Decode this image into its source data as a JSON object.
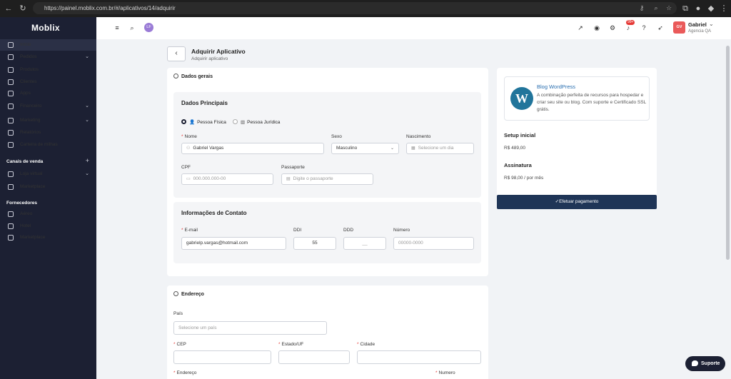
{
  "browser": {
    "url": "https://painel.moblix.com.br/#/aplicativos/14/adquirir"
  },
  "sidebar": {
    "logo": "Moblix",
    "items": [
      {
        "label": "Início",
        "active": true
      },
      {
        "label": "Pedidos",
        "chevron": true
      },
      {
        "label": "Produtos"
      },
      {
        "label": "Clientes"
      },
      {
        "label": "Apps"
      },
      {
        "label": "Financeiro",
        "chevron": true
      },
      {
        "label": "Marketing",
        "chevron": true
      },
      {
        "label": "Relatórios"
      },
      {
        "label": "Carteira de milhas"
      }
    ],
    "sales_channels_heading": "Canais de venda",
    "sales_channels": [
      {
        "label": "Loja virtual",
        "chevron": true
      },
      {
        "label": "Marketplace"
      }
    ],
    "suppliers_heading": "Fornecedores",
    "suppliers": [
      {
        "label": "Aéreo"
      },
      {
        "label": "Hotel"
      },
      {
        "label": "Marketplace"
      }
    ]
  },
  "topbar": {
    "avatar_initials": "LF",
    "notification_badge": "99+",
    "user_initials": "GV",
    "user_name": "Gabriel",
    "user_company": "Agencia QA"
  },
  "page": {
    "title": "Adquirir Aplicativo",
    "subtitle": "Adquirir aplicativo"
  },
  "general": {
    "section_title": "Dados gerais",
    "main_panel_title": "Dados Principais",
    "radio_fisica": "Pessoa Física",
    "radio_juridica": "Pessoa Jurídica",
    "name_label": "Nome",
    "name_value": "Gabriel Vargas",
    "sex_label": "Sexo",
    "sex_value": "Masculino",
    "birth_label": "Nascimento",
    "birth_placeholder": "Selecione um dia",
    "cpf_label": "CPF",
    "cpf_placeholder": "000.000.000-00",
    "passport_label": "Passaporte",
    "passport_placeholder": "Digite o passaporte",
    "contact_panel_title": "Informações de Contato",
    "email_label": "E-mail",
    "email_value": "gabrielp.vargas@hotmail.com",
    "ddi_label": "DDI",
    "ddi_value": "55",
    "ddd_label": "DDD",
    "ddd_placeholder": "__",
    "number_label": "Número",
    "number_placeholder": "00000-0000"
  },
  "address": {
    "section_title": "Endereço",
    "country_label": "País",
    "country_placeholder": "Selecione um país",
    "cep_label": "CEP",
    "state_label": "Estado/UF",
    "city_label": "Cidade",
    "street_label": "Endereço",
    "number_label": "Numero"
  },
  "summary": {
    "app_name": "Blog WordPress",
    "app_desc": "A combinação perfeita de recursos para hospedar e criar seu site ou blog. Com suporte e Certificado SSL grátis.",
    "setup_title": "Setup inicial",
    "setup_value": "R$ 489,00",
    "subscription_title": "Assinatura",
    "subscription_value": "R$ 98,00 / por mês",
    "pay_button": "Efetuar pagamento"
  },
  "support_button": "Suporte"
}
